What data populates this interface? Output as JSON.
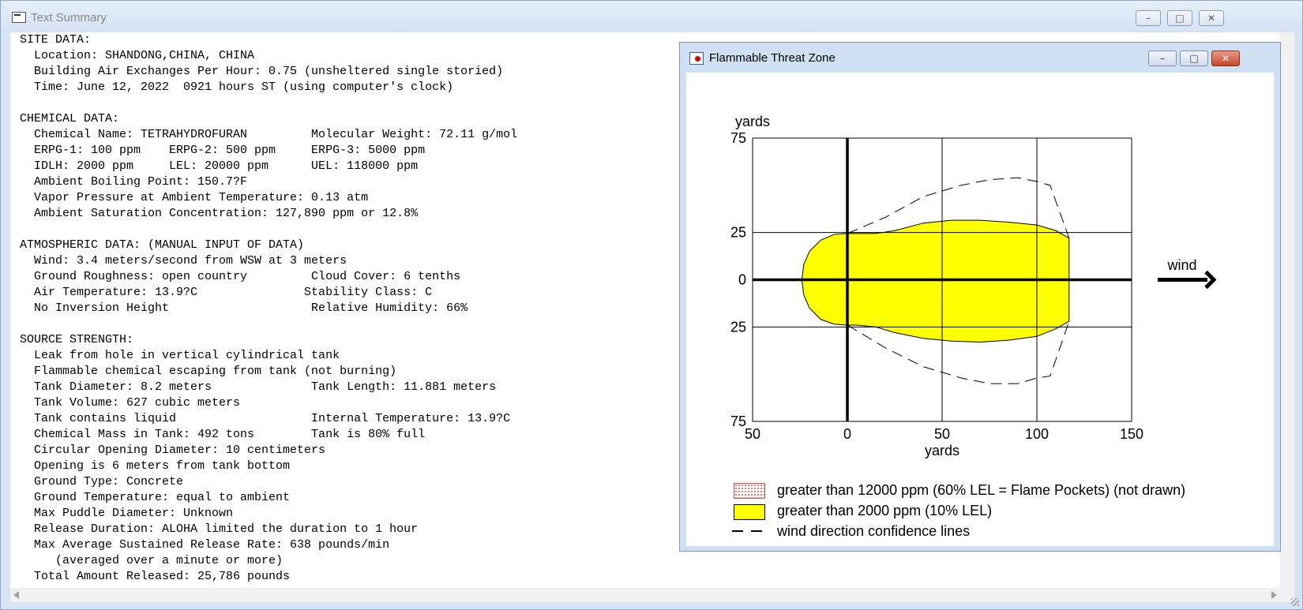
{
  "window": {
    "title": "Text Summary",
    "controls": {
      "minimize": "–",
      "maximize": "□",
      "close": "✕"
    }
  },
  "summary_lines": [
    "SITE DATA:",
    "  Location: SHANDONG,CHINA, CHINA",
    "  Building Air Exchanges Per Hour: 0.75 (unsheltered single storied)",
    "  Time: June 12, 2022  0921 hours ST (using computer's clock)",
    "",
    "CHEMICAL DATA:",
    "  Chemical Name: TETRAHYDROFURAN         Molecular Weight: 72.11 g/mol",
    "  ERPG-1: 100 ppm    ERPG-2: 500 ppm     ERPG-3: 5000 ppm",
    "  IDLH: 2000 ppm     LEL: 20000 ppm      UEL: 118000 ppm",
    "  Ambient Boiling Point: 150.7?F",
    "  Vapor Pressure at Ambient Temperature: 0.13 atm",
    "  Ambient Saturation Concentration: 127,890 ppm or 12.8%",
    "",
    "ATMOSPHERIC DATA: (MANUAL INPUT OF DATA)",
    "  Wind: 3.4 meters/second from WSW at 3 meters",
    "  Ground Roughness: open country         Cloud Cover: 6 tenths",
    "  Air Temperature: 13.9?C               Stability Class: C",
    "  No Inversion Height                    Relative Humidity: 66%",
    "",
    "SOURCE STRENGTH:",
    "  Leak from hole in vertical cylindrical tank",
    "  Flammable chemical escaping from tank (not burning)",
    "  Tank Diameter: 8.2 meters              Tank Length: 11.881 meters",
    "  Tank Volume: 627 cubic meters",
    "  Tank contains liquid                   Internal Temperature: 13.9?C",
    "  Chemical Mass in Tank: 492 tons        Tank is 80% full",
    "  Circular Opening Diameter: 10 centimeters",
    "  Opening is 6 meters from tank bottom",
    "  Ground Type: Concrete",
    "  Ground Temperature: equal to ambient",
    "  Max Puddle Diameter: Unknown",
    "  Release Duration: ALOHA limited the duration to 1 hour",
    "  Max Average Sustained Release Rate: 638 pounds/min",
    "     (averaged over a minute or more)",
    "  Total Amount Released: 25,786 pounds"
  ],
  "threat_zone": {
    "title": "Flammable Threat Zone",
    "controls": {
      "minimize": "–",
      "maximize": "□",
      "close": "✕"
    },
    "wind_label": "wind",
    "legend": [
      {
        "label": "greater than 12000 ppm (60% LEL = Flame Pockets) (not drawn)",
        "color": "#e06a6a"
      },
      {
        "label": "greater than 2000 ppm (10% LEL)",
        "color": "#ffff00"
      },
      {
        "label": "wind direction confidence lines",
        "color": "#000000"
      }
    ]
  },
  "chart_data": {
    "type": "area",
    "xlabel": "yards",
    "ylabel": "yards",
    "xlim": [
      -50,
      150
    ],
    "ylim": [
      -75,
      75
    ],
    "x_ticks": [
      -50,
      0,
      50,
      100,
      150
    ],
    "x_tick_labels": [
      "50",
      "0",
      "50",
      "100",
      "150"
    ],
    "y_ticks": [
      75,
      25,
      0,
      -25,
      -75
    ],
    "y_tick_labels": [
      "75",
      "25",
      "0",
      "25",
      "75"
    ],
    "grid": true,
    "series": [
      {
        "name": "greater than 2000 ppm (10% LEL)",
        "fill": "#ffff00",
        "points": [
          [
            -24,
            0
          ],
          [
            -23,
            8
          ],
          [
            -20,
            15
          ],
          [
            -14,
            21
          ],
          [
            -7,
            24
          ],
          [
            0,
            24.5
          ],
          [
            5,
            24.5
          ],
          [
            15,
            24.5
          ],
          [
            25,
            26
          ],
          [
            40,
            30
          ],
          [
            55,
            31.5
          ],
          [
            70,
            31.5
          ],
          [
            85,
            30.5
          ],
          [
            100,
            29
          ],
          [
            110,
            26
          ],
          [
            117,
            22
          ],
          [
            117,
            -22
          ],
          [
            110,
            -26
          ],
          [
            100,
            -30
          ],
          [
            85,
            -32
          ],
          [
            70,
            -33
          ],
          [
            55,
            -32.5
          ],
          [
            40,
            -31
          ],
          [
            25,
            -28
          ],
          [
            15,
            -25
          ],
          [
            5,
            -24
          ],
          [
            0,
            -24
          ],
          [
            -7,
            -23.5
          ],
          [
            -14,
            -21
          ],
          [
            -20,
            -15
          ],
          [
            -23,
            -8
          ]
        ]
      },
      {
        "name": "wind direction confidence lines",
        "style": "dashed",
        "upper": [
          [
            0,
            24.5
          ],
          [
            20,
            33
          ],
          [
            40,
            44
          ],
          [
            60,
            50
          ],
          [
            75,
            53
          ],
          [
            90,
            54
          ],
          [
            100,
            52
          ],
          [
            107,
            50
          ],
          [
            117,
            22
          ]
        ],
        "lower": [
          [
            0,
            -24
          ],
          [
            20,
            -36
          ],
          [
            40,
            -46
          ],
          [
            60,
            -52
          ],
          [
            75,
            -55
          ],
          [
            90,
            -55
          ],
          [
            100,
            -52
          ],
          [
            107,
            -51
          ],
          [
            117,
            -22
          ]
        ]
      }
    ]
  }
}
